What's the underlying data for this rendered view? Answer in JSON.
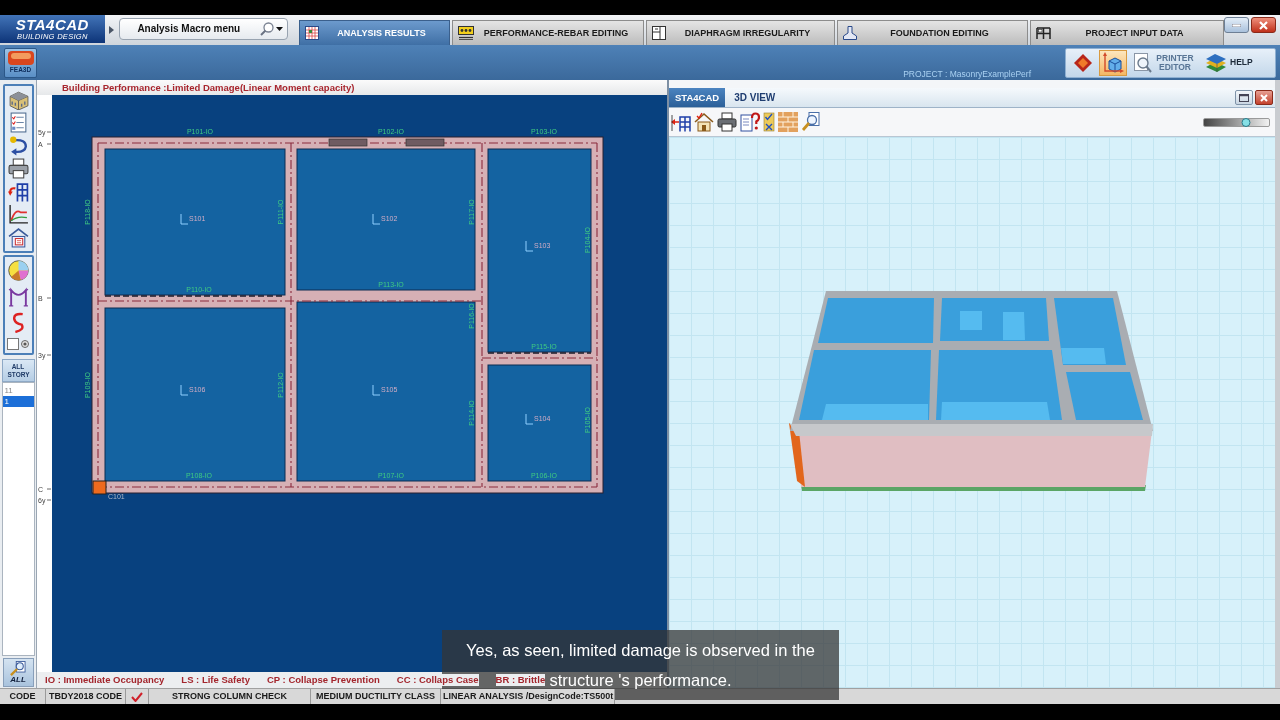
{
  "header": {
    "logo_title": "STA4CAD",
    "logo_subtitle": "BUILDING DESIGN",
    "macro_menu": "Analysis Macro menu"
  },
  "tabs": [
    {
      "label": "ANALYSIS RESULTS",
      "kind": "results",
      "selected": true
    },
    {
      "label": "PERFORMANCE-REBAR EDITING",
      "kind": "rebar",
      "selected": false
    },
    {
      "label": "DIAPHRAGM IRREGULARITY",
      "kind": "diaphragm",
      "selected": false
    },
    {
      "label": "FOUNDATION EDITING",
      "kind": "foundation",
      "selected": false
    },
    {
      "label": "PROJECT INPUT DATA",
      "kind": "project",
      "selected": false
    }
  ],
  "ribbon": {
    "fea_button": "FEA3D",
    "project": "PROJECT : MasonryExamplePerf",
    "icon_tools": [
      {
        "kind": "diamond",
        "selected": false
      },
      {
        "kind": "cube",
        "selected": true
      }
    ],
    "printer_editor": {
      "label": "PRINTER EDITOR",
      "disabled": true
    },
    "help": {
      "label": "HELP"
    }
  },
  "sidebar": {
    "toggle": {
      "checked": false
    },
    "story_button": "ALL STORY",
    "stories": [
      {
        "label": "11",
        "selected": false
      },
      {
        "label": "1",
        "selected": true
      }
    ],
    "zoom_all": "ALL"
  },
  "plan": {
    "title": "Building Performance :Limited Damage(Linear Moment capacity)",
    "axes": [
      "5y",
      "A",
      "B",
      "3y",
      "C",
      "6y"
    ],
    "walls": [
      "P101-IO",
      "P102-IO",
      "P103-IO",
      "P118-IO",
      "P111-IO",
      "P117-IO",
      "P104-IO",
      "P110-IO",
      "P113-IO",
      "P116-IO",
      "P115-IO",
      "P109-IO",
      "P112-IO",
      "P114-IO",
      "P105-IO",
      "P108-IO",
      "P107-IO",
      "P106-IO"
    ],
    "slabs": [
      "S101",
      "S102",
      "S103",
      "S104",
      "S105",
      "S106"
    ],
    "column": "C101",
    "legend": [
      "IO : Immediate Occupancy",
      "LS : Life Safety",
      "CP : Collapse Prevention",
      "CC : Collaps Case",
      "BR : Brittle"
    ]
  },
  "view3d": {
    "tab": "STA4CAD",
    "title": "3D VIEW",
    "zoom_slider": {
      "level": 0.65
    }
  },
  "status_bar": [
    {
      "kind": "text",
      "text": "CODE"
    },
    {
      "kind": "text",
      "text": "TBDY2018 CODE"
    },
    {
      "kind": "check",
      "checked": true
    },
    {
      "kind": "text",
      "text": "STRONG COLUMN CHECK"
    },
    {
      "kind": "text",
      "text": "MEDIUM DUCTILITY CLASS"
    },
    {
      "kind": "text",
      "text": "LINEAR ANALYSIS /DesignCode:TS500t"
    }
  ],
  "subtitle": "Yes, as seen, limited damage is observed in the structure 's performance."
}
